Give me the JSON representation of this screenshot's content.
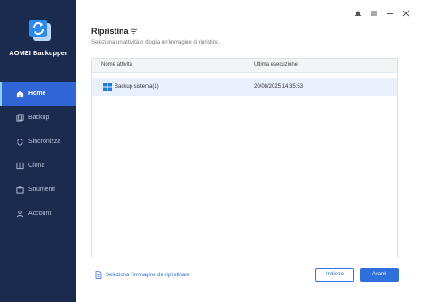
{
  "app": {
    "brand": "AOMEI Backupper"
  },
  "sidebar": {
    "items": [
      {
        "label": "Home",
        "icon": "home-icon",
        "active": true
      },
      {
        "label": "Backup",
        "icon": "backup-icon",
        "active": false
      },
      {
        "label": "Sincronizza",
        "icon": "sync-icon",
        "active": false
      },
      {
        "label": "Clona",
        "icon": "clone-icon",
        "active": false
      },
      {
        "label": "Strumenti",
        "icon": "tools-icon",
        "active": false
      },
      {
        "label": "Account",
        "icon": "account-icon",
        "active": false
      }
    ]
  },
  "main": {
    "title": "Ripristina",
    "subtitle": "Seleziona un'attività o sfoglia un'immagine di ripristino.",
    "table": {
      "headers": [
        "Nome attività",
        "Ultima esecuzione"
      ],
      "rows": [
        {
          "name": "Backup sistema(1)",
          "last_run": "20/08/2025 14:35:53"
        }
      ]
    },
    "footer_link": "Seleziona l'immagine da ripristinare",
    "back_button": "Indietro",
    "next_button": "Avanti"
  },
  "colors": {
    "sidebar_bg": "#1b2b4e",
    "accent": "#2f6fdb",
    "active_nav": "#3166d6",
    "selected_row": "#e8f0fc"
  }
}
